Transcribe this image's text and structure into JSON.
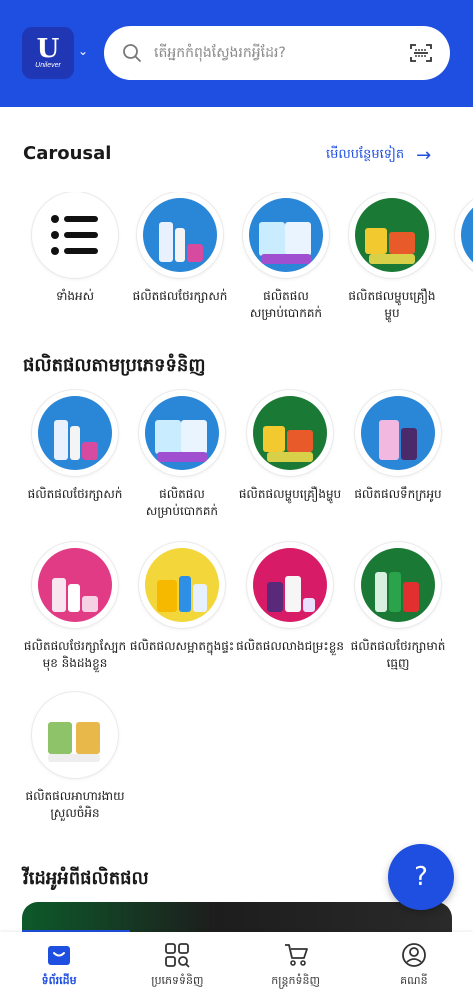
{
  "header": {
    "logo_text": "Unilever",
    "logo_letter": "U",
    "search_placeholder": "តើអ្នកកំពុងស្វែងរកអ្វីដែរ?"
  },
  "carousel": {
    "title": "Carousal",
    "see_more": "មើលបន្ថែមទៀត",
    "items": [
      {
        "label": "ទាំងអស់"
      },
      {
        "label": "ផលិតផលថែរក្សាសក់"
      },
      {
        "label": "ផលិតផលសម្រាប់បោកគក់"
      },
      {
        "label": "ផលិតផលម្ហូបគ្រឿងម្ហូប"
      },
      {
        "label": "ផ"
      }
    ]
  },
  "categories": {
    "title": "ផលិតផលតាមប្រភេទទំនិញ",
    "items": [
      {
        "label": "ផលិតផលថែរក្សាសក់"
      },
      {
        "label": "ផលិតផលសម្រាប់បោកគក់"
      },
      {
        "label": "ផលិតផលម្ហូបគ្រឿងម្ហូប"
      },
      {
        "label": "ផលិតផលទឹកក្រអូប"
      },
      {
        "label": "ផលិតផលថែរក្សាស្បែកមុខ និងដងខ្លួន"
      },
      {
        "label": "ផលិតផលសម្អាតក្នុងផ្ទះ"
      },
      {
        "label": "ផលិតផលលាងជម្រះខ្លួន"
      },
      {
        "label": "ផលិតផលថែរក្សាមាត់ធ្មេញ"
      },
      {
        "label": "ផលិតផលអាហារងាយស្រួលចំអិន"
      }
    ]
  },
  "videos": {
    "title": "វីដេអូអំពីផលិតផល"
  },
  "fab": {
    "label": "?"
  },
  "bottom_nav": [
    {
      "label": "ទំព័រដើម",
      "icon": "home-icon",
      "active": true
    },
    {
      "label": "ប្រភេទទំនិញ",
      "icon": "categories-icon",
      "active": false
    },
    {
      "label": "កន្ត្រកទំនិញ",
      "icon": "cart-icon",
      "active": false
    },
    {
      "label": "គណនី",
      "icon": "account-icon",
      "active": false
    }
  ],
  "colors": {
    "brand_blue": "#1f4fe0",
    "circle_blue": "#2a86d6",
    "circle_green": "#1a7a35",
    "circle_pink": "#e23b86",
    "circle_yellow": "#f2d63a",
    "circle_magenta": "#d81b67"
  }
}
